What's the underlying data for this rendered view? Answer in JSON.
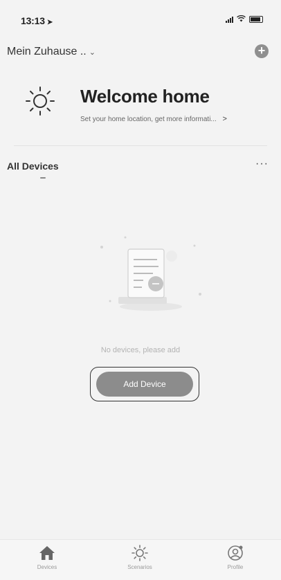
{
  "status": {
    "time": "13:13"
  },
  "header": {
    "home_name": "Mein Zuhause ..",
    "add_button_icon": "plus-icon"
  },
  "welcome": {
    "title": "Welcome home",
    "subtitle": "Set your home location, get more informati...",
    "arrow": ">"
  },
  "devices": {
    "tab_label": "All Devices",
    "more_label": "···"
  },
  "empty_state": {
    "message": "No devices, please add",
    "button_label": "Add Device"
  },
  "tabbar": {
    "items": [
      {
        "label": "Devices",
        "icon": "home-icon"
      },
      {
        "label": "Scenarios",
        "icon": "sun-icon"
      },
      {
        "label": "Profile",
        "icon": "profile-icon"
      }
    ]
  },
  "colors": {
    "background": "#f3f3f3",
    "button": "#8c8c8c",
    "text": "#222222"
  }
}
